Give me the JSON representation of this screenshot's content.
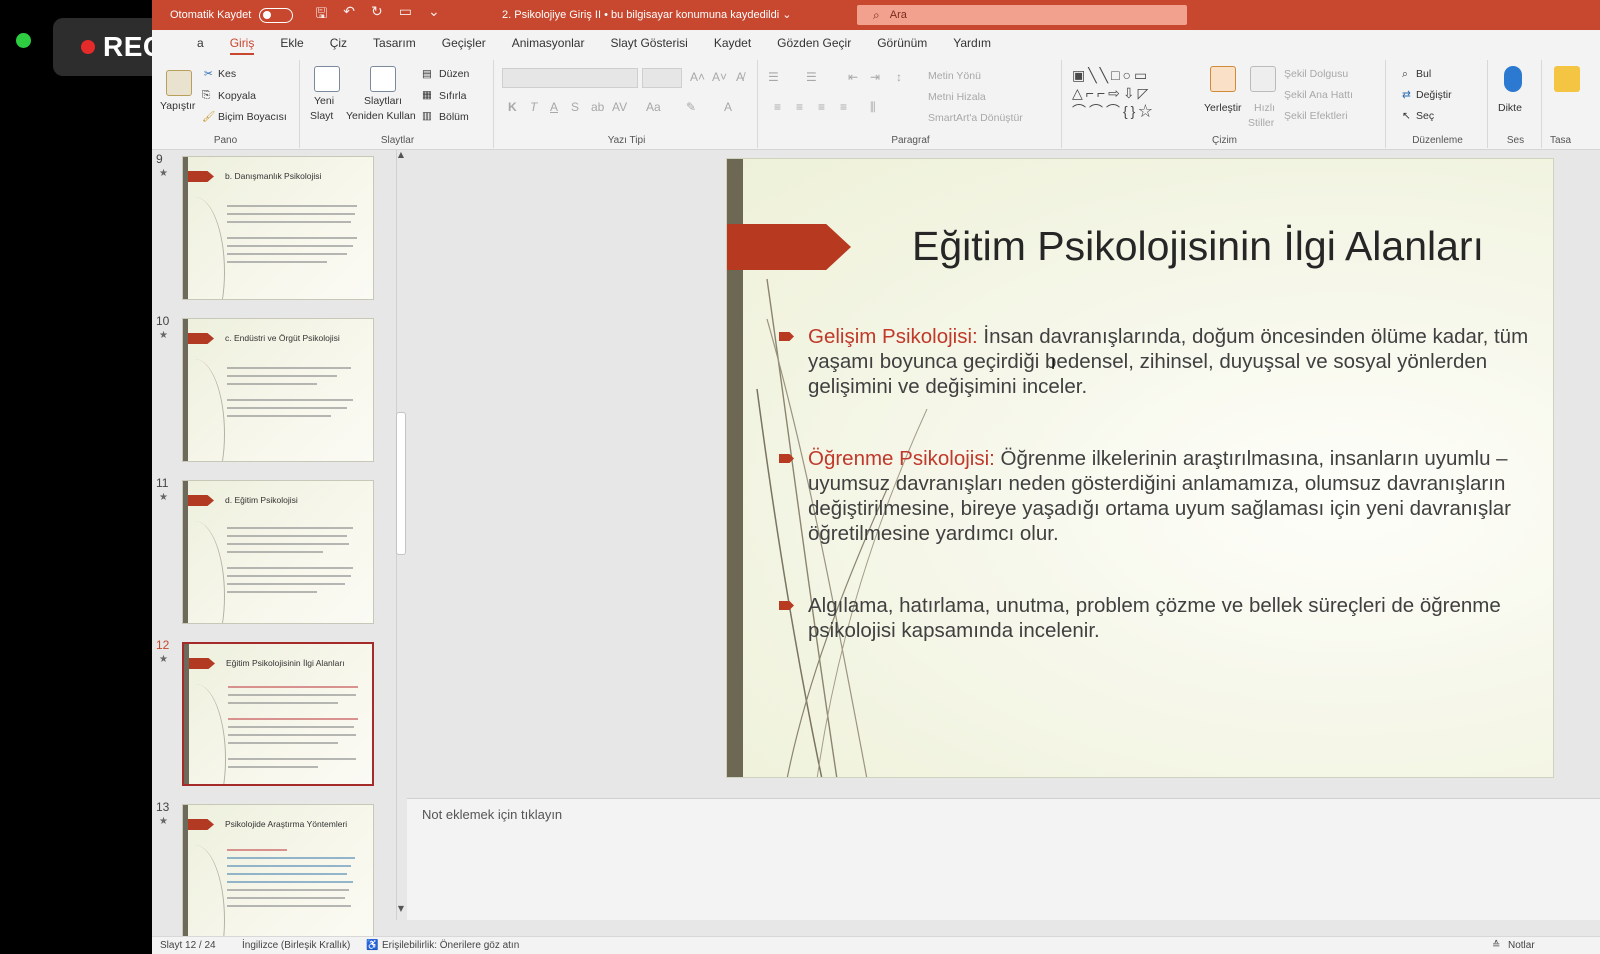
{
  "recorder": {
    "label": "REC"
  },
  "titlebar": {
    "autosave_label": "Otomatik Kaydet",
    "document_title": "2. Psikolojiye Giriş II  •  bu bilgisayar konumuna kaydedildi",
    "search_placeholder": "Ara"
  },
  "menu": {
    "tabs": [
      "a",
      "Giriş",
      "Ekle",
      "Çiz",
      "Tasarım",
      "Geçişler",
      "Animasyonlar",
      "Slayt Gösterisi",
      "Kaydet",
      "Gözden Geçir",
      "Görünüm",
      "Yardım"
    ],
    "active": "Giriş"
  },
  "ribbon": {
    "pano": {
      "label": "Pano",
      "paste": "Yapıştır",
      "cut": "Kes",
      "copy": "Kopyala",
      "format_painter": "Biçim Boyacısı"
    },
    "slaytlar": {
      "label": "Slaytlar",
      "new_slide_1": "Yeni",
      "new_slide_2": "Slayt",
      "reuse_1": "Slaytları",
      "reuse_2": "Yeniden Kullan",
      "layout": "Düzen",
      "reset": "Sıfırla",
      "section": "Bölüm"
    },
    "yazi_tipi": {
      "label": "Yazı Tipi"
    },
    "paragraf": {
      "label": "Paragraf",
      "text_direction": "Metin Yönü",
      "align_text": "Metni Hizala",
      "smartart": "SmartArt'a Dönüştür"
    },
    "cizim": {
      "label": "Çizim",
      "arrange": "Yerleştir",
      "quick_styles_1": "Hızlı",
      "quick_styles_2": "Stiller",
      "shape_fill": "Şekil Dolgusu",
      "shape_outline": "Şekil Ana Hattı",
      "shape_effects": "Şekil Efektleri"
    },
    "duzenleme": {
      "label": "Düzenleme",
      "find": "Bul",
      "replace": "Değiştir",
      "select": "Seç"
    },
    "ses": {
      "label": "Ses",
      "dictate": "Dikte"
    },
    "tasarim": {
      "label": "Tasa"
    }
  },
  "thumbnails": [
    {
      "num": "9",
      "title": "b. Danışmanlık Psikolojisi"
    },
    {
      "num": "10",
      "title": "c. Endüstri ve Örgüt Psikolojisi"
    },
    {
      "num": "11",
      "title": "d. Eğitim Psikolojisi"
    },
    {
      "num": "12",
      "title": "Eğitim Psikolojisinin İlgi Alanları"
    },
    {
      "num": "13",
      "title": "Psikolojide Araştırma Yöntemleri"
    }
  ],
  "slide": {
    "title": "Eğitim Psikolojisinin İlgi Alanları",
    "bullets": [
      {
        "highlight": "Gelişim Psikolojisi:",
        "text": " İnsan davranışlarında, doğum öncesinden ölüme kadar, tüm yaşamı boyunca geçirdiği bedensel, zihinsel, duyuşsal ve sosyal yönlerden gelişimini ve değişimini inceler."
      },
      {
        "highlight": "Öğrenme Psikolojisi:",
        "text": " Öğrenme ilkelerinin araştırılmasına, insanların uyumlu – uyumsuz davranışları neden gösterdiğini anlamamıza, olumsuz davranışların değiştirilmesine, bireye yaşadığı ortama uyum sağlaması için yeni davranışlar öğretilmesine yardımcı olur."
      },
      {
        "highlight": "",
        "text": "Algılama, hatırlama, unutma, problem çözme ve bellek süreçleri de öğrenme psikolojisi kapsamında incelenir."
      }
    ]
  },
  "notes": {
    "placeholder": "Not eklemek için tıklayın"
  },
  "status": {
    "slide_info": "Slayt 12 / 24",
    "language": "İngilizce (Birleşik Krallık)",
    "accessibility": "Erişilebilirlik: Önerilere göz atın",
    "notes_button": "Notlar"
  },
  "colors": {
    "accent": "#c7472f",
    "highlight": "#c0392b",
    "slide_bar": "#6c6854"
  }
}
